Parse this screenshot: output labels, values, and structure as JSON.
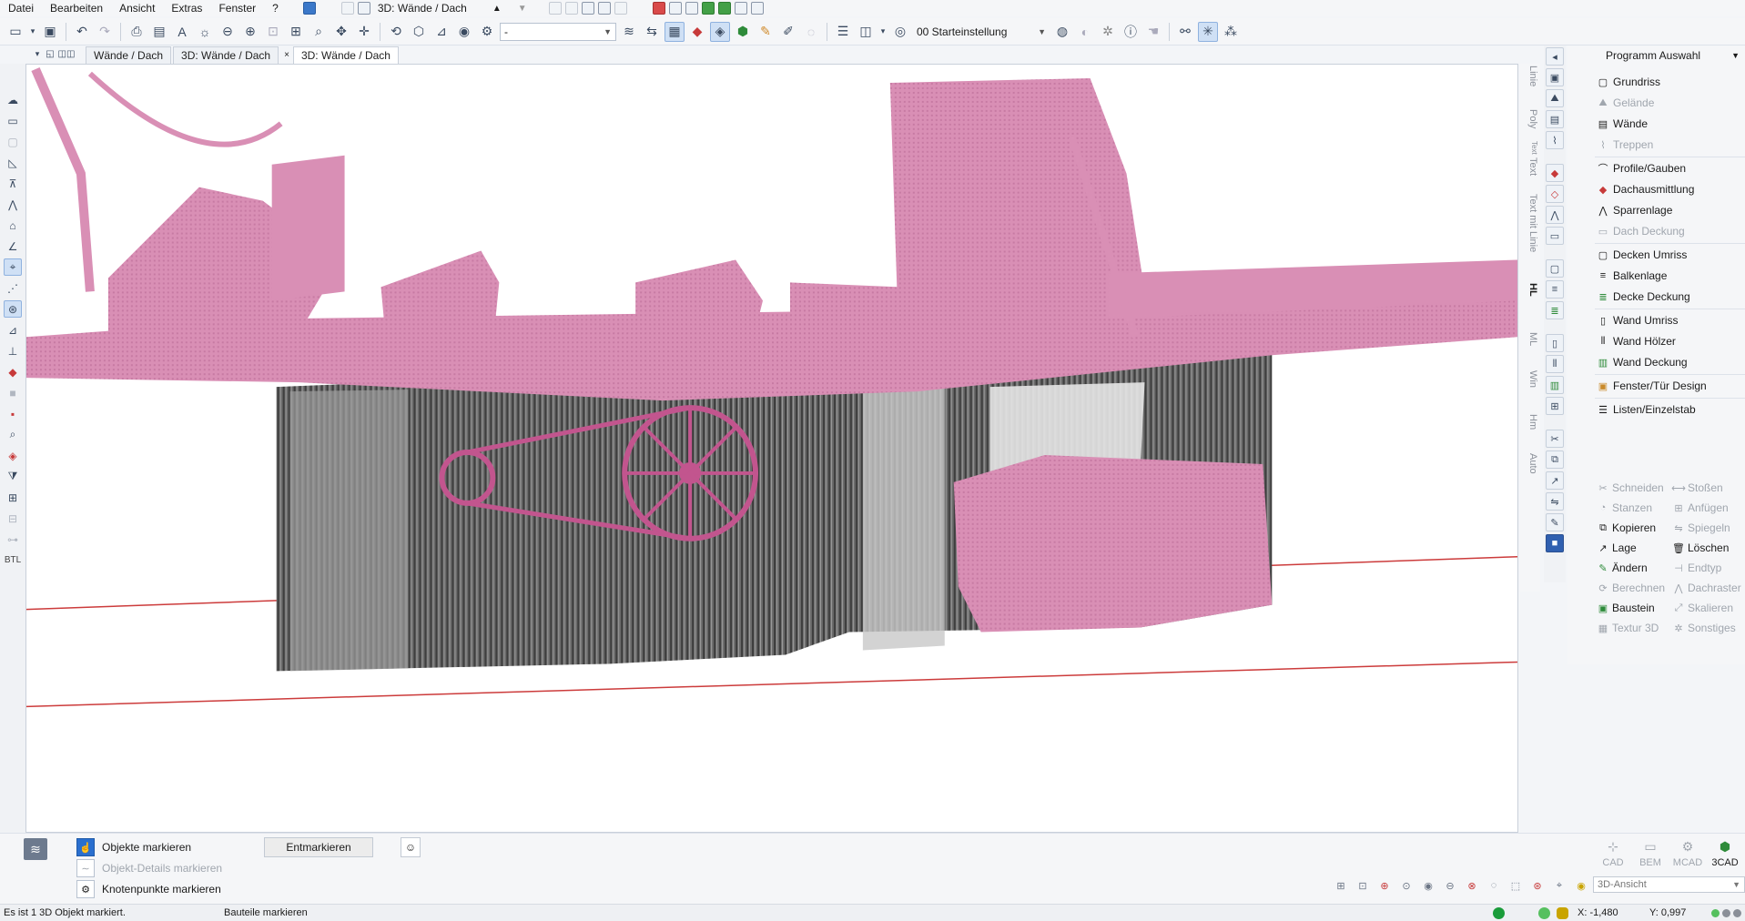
{
  "menu": {
    "items": [
      "Datei",
      "Bearbeiten",
      "Ansicht",
      "Extras",
      "Fenster",
      "?"
    ],
    "view_title": "3D: Wände / Dach"
  },
  "toolbar": {
    "combo_empty": "-",
    "starting_state": "00 Starteinstellung"
  },
  "tabs": [
    "Wände / Dach",
    "3D: Wände / Dach",
    "×",
    "3D: Wände / Dach"
  ],
  "left_tools": {
    "btl_label": "BTL"
  },
  "vertical_labels": [
    "Linie",
    "Poly",
    "Text",
    "Text",
    "Text mit Linie",
    "HL",
    "ML",
    "Win",
    "Hm",
    "Auto"
  ],
  "program_panel": {
    "header": "Programm Auswahl",
    "items": [
      {
        "label": "Grundriss",
        "enabled": true
      },
      {
        "label": "Gelände",
        "enabled": false
      },
      {
        "label": "Wände",
        "enabled": true
      },
      {
        "label": "Treppen",
        "enabled": false
      },
      {
        "label": "Profile/Gauben",
        "enabled": true
      },
      {
        "label": "Dachausmittlung",
        "enabled": true
      },
      {
        "label": "Sparrenlage",
        "enabled": true
      },
      {
        "label": "Dach Deckung",
        "enabled": false
      },
      {
        "label": "Decken Umriss",
        "enabled": true
      },
      {
        "label": "Balkenlage",
        "enabled": true
      },
      {
        "label": "Decke Deckung",
        "enabled": true
      },
      {
        "label": "Wand Umriss",
        "enabled": true
      },
      {
        "label": "Wand Hölzer",
        "enabled": true
      },
      {
        "label": "Wand Deckung",
        "enabled": true
      },
      {
        "label": "Fenster/Tür Design",
        "enabled": true
      },
      {
        "label": "Listen/Einzelstab",
        "enabled": true
      }
    ],
    "edit_tools": [
      {
        "label": "Schneiden",
        "enabled": false
      },
      {
        "label": "Stoßen",
        "enabled": false
      },
      {
        "label": "Stanzen",
        "enabled": false
      },
      {
        "label": "Anfügen",
        "enabled": false
      },
      {
        "label": "Kopieren",
        "enabled": true
      },
      {
        "label": "Spiegeln",
        "enabled": false
      },
      {
        "label": "Lage",
        "enabled": true
      },
      {
        "label": "Löschen",
        "enabled": true
      },
      {
        "label": "Ändern",
        "enabled": true
      },
      {
        "label": "Endtyp",
        "enabled": false
      },
      {
        "label": "Berechnen",
        "enabled": false
      },
      {
        "label": "Dachraster",
        "enabled": false
      },
      {
        "label": "Baustein",
        "enabled": true
      },
      {
        "label": "Skalieren",
        "enabled": false
      },
      {
        "label": "Textur 3D",
        "enabled": false
      },
      {
        "label": "Sonstiges",
        "enabled": false
      }
    ]
  },
  "bottom": {
    "mark_objects": "Objekte markieren",
    "mark_details": "Objekt-Details markieren",
    "mark_nodes": "Knotenpunkte markieren",
    "unmark": "Entmarkieren",
    "modes": [
      {
        "label": "CAD",
        "active": false
      },
      {
        "label": "BEM",
        "active": false
      },
      {
        "label": "MCAD",
        "active": false
      },
      {
        "label": "3CAD",
        "active": true
      }
    ],
    "view_combo": "3D-Ansicht"
  },
  "status": {
    "message": "Es ist 1 3D Objekt markiert.",
    "action": "Bauteile markieren",
    "x": "X: -1,480",
    "y": "Y: 0,997"
  },
  "colors": {
    "pointcloud_pink": "#d98fb5",
    "pointcloud_gray": "#8a8a8a",
    "ground_line": "#cc3b3b",
    "accent_blue": "#2a6fcf"
  }
}
